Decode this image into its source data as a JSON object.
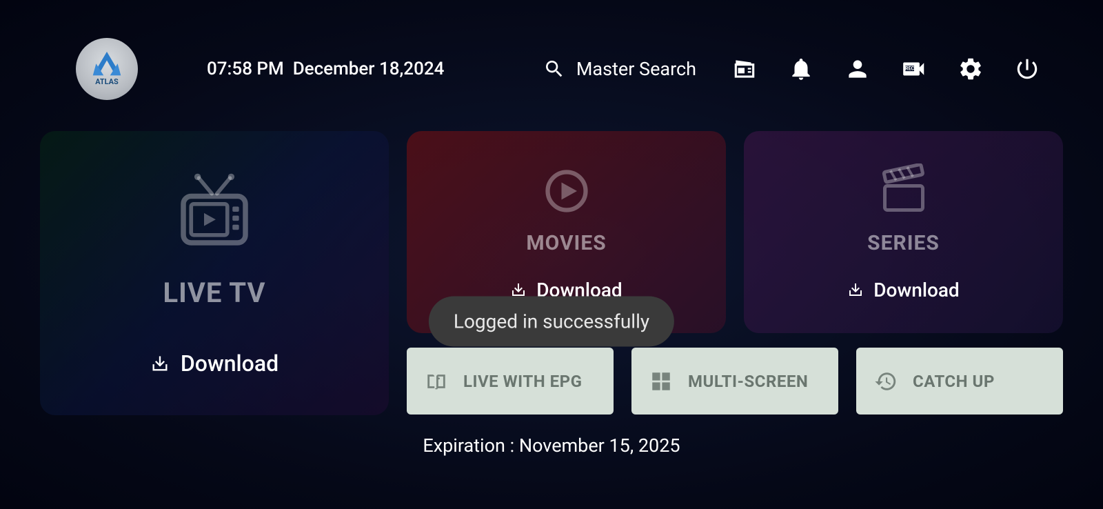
{
  "header": {
    "logo_name": "ATLAS",
    "time": "07:58 PM",
    "date": "December 18,2024",
    "search_label": "Master Search"
  },
  "tiles": {
    "live": {
      "title": "LIVE TV",
      "download": "Download"
    },
    "movies": {
      "title": "MOVIES",
      "download": "Download"
    },
    "series": {
      "title": "SERIES",
      "download": "Download"
    }
  },
  "small_tiles": {
    "epg": "LIVE WITH EPG",
    "multi": "MULTI-SCREEN",
    "catchup": "CATCH UP"
  },
  "footer": {
    "expiration": "Expiration : November 15, 2025"
  },
  "toast": {
    "message": "Logged in successfully"
  }
}
